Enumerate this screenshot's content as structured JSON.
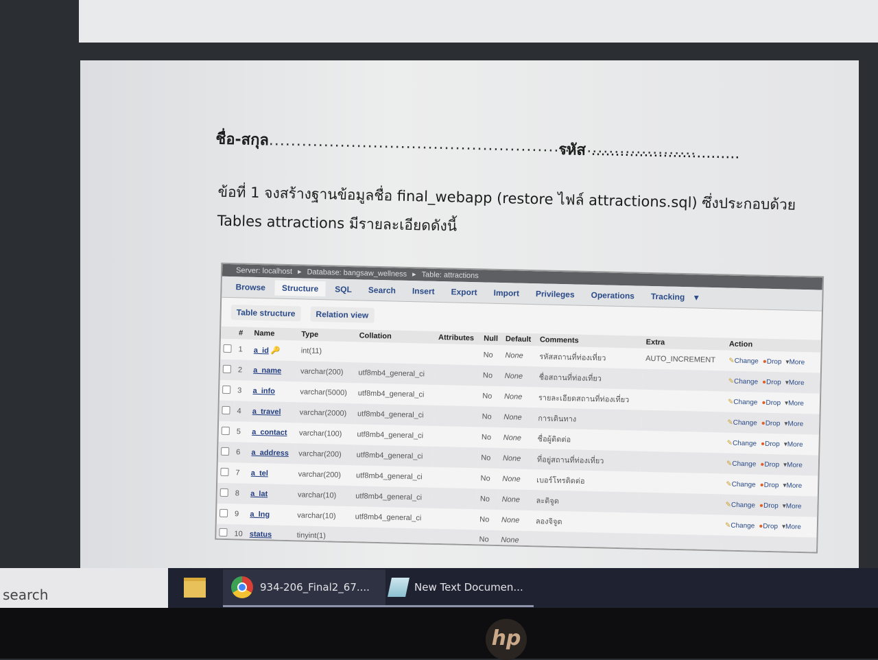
{
  "document": {
    "name_label": "ชื่อ-สกุล",
    "name_dots": "..............................................................................",
    "id_label": "รหัส",
    "id_dots": "...............................",
    "question": "ข้อที่ 1 จงสร้างฐานข้อมูลชื่อ final_webapp (restore ไฟล์ attractions.sql) ซึ่งประกอบด้วย Tables attractions มีรายละเอียดดังนี้"
  },
  "phpmyadmin": {
    "breadcrumb": [
      "Server: localhost",
      "Database: bangsaw_wellness",
      "Table: attractions"
    ],
    "tabs": [
      "Browse",
      "Structure",
      "SQL",
      "Search",
      "Insert",
      "Export",
      "Import",
      "Privileges",
      "Operations",
      "Tracking"
    ],
    "active_tab": "Structure",
    "subtabs": [
      "Table structure",
      "Relation view"
    ],
    "columns": [
      "#",
      "Name",
      "Type",
      "Collation",
      "Attributes",
      "Null",
      "Default",
      "Comments",
      "Extra",
      "Action"
    ],
    "actions": [
      "Change",
      "Drop",
      "More"
    ],
    "rows": [
      {
        "n": "1",
        "name": "a_id",
        "type": "int(11)",
        "collation": "",
        "null": "No",
        "default": "None",
        "comment": "รหัสสถานที่ท่องเที่ยว",
        "extra": "AUTO_INCREMENT",
        "primary": true
      },
      {
        "n": "2",
        "name": "a_name",
        "type": "varchar(200)",
        "collation": "utf8mb4_general_ci",
        "null": "No",
        "default": "None",
        "comment": "ชื่อสถานที่ท่องเที่ยว",
        "extra": ""
      },
      {
        "n": "3",
        "name": "a_info",
        "type": "varchar(5000)",
        "collation": "utf8mb4_general_ci",
        "null": "No",
        "default": "None",
        "comment": "รายละเอียดสถานที่ท่องเที่ยว",
        "extra": ""
      },
      {
        "n": "4",
        "name": "a_travel",
        "type": "varchar(2000)",
        "collation": "utf8mb4_general_ci",
        "null": "No",
        "default": "None",
        "comment": "การเดินทาง",
        "extra": ""
      },
      {
        "n": "5",
        "name": "a_contact",
        "type": "varchar(100)",
        "collation": "utf8mb4_general_ci",
        "null": "No",
        "default": "None",
        "comment": "ชื่อผู้ติดต่อ",
        "extra": ""
      },
      {
        "n": "6",
        "name": "a_address",
        "type": "varchar(200)",
        "collation": "utf8mb4_general_ci",
        "null": "No",
        "default": "None",
        "comment": "ที่อยู่สถานที่ท่องเที่ยว",
        "extra": ""
      },
      {
        "n": "7",
        "name": "a_tel",
        "type": "varchar(200)",
        "collation": "utf8mb4_general_ci",
        "null": "No",
        "default": "None",
        "comment": "เบอร์โทรติดต่อ",
        "extra": ""
      },
      {
        "n": "8",
        "name": "a_lat",
        "type": "varchar(10)",
        "collation": "utf8mb4_general_ci",
        "null": "No",
        "default": "None",
        "comment": "ละติจูด",
        "extra": ""
      },
      {
        "n": "9",
        "name": "a_lng",
        "type": "varchar(10)",
        "collation": "utf8mb4_general_ci",
        "null": "No",
        "default": "None",
        "comment": "ลองจิจูด",
        "extra": ""
      },
      {
        "n": "10",
        "name": "status",
        "type": "tinyint(1)",
        "collation": "",
        "null": "No",
        "default": "None",
        "comment": "",
        "extra": ""
      }
    ]
  },
  "taskbar": {
    "search_text": "search",
    "items": [
      {
        "icon": "file-explorer-icon",
        "label": ""
      },
      {
        "icon": "chrome-icon",
        "label": "934-206_Final2_67...."
      },
      {
        "icon": "notepad-icon",
        "label": "New Text Documen..."
      }
    ]
  },
  "bezel": {
    "logo": "hp"
  }
}
